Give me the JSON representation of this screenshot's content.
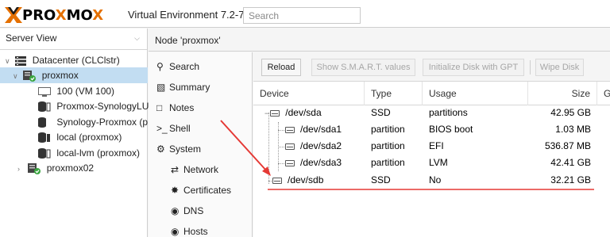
{
  "header": {
    "logo_prefix": "PRO",
    "logo_x1": "X",
    "logo_mid": "MO",
    "logo_x2": "X",
    "version_text": "Virtual Environment 7.2-7",
    "search_placeholder": "Search"
  },
  "tree": {
    "view_label": "Server View",
    "items": [
      {
        "label": "Datacenter (CLClstr)",
        "icon": "datacenter-icon"
      },
      {
        "label": "proxmox",
        "icon": "node-online-icon"
      },
      {
        "label": "100 (VM 100)",
        "icon": "vm-icon"
      },
      {
        "label": "Proxmox-SynologyLU",
        "icon": "storage-icon"
      },
      {
        "label": "Synology-Proxmox (p",
        "icon": "storage-icon"
      },
      {
        "label": "local (proxmox)",
        "icon": "storage-icon"
      },
      {
        "label": "local-lvm (proxmox)",
        "icon": "storage-icon"
      },
      {
        "label": "proxmox02",
        "icon": "node-online-icon"
      }
    ]
  },
  "node_header": "Node 'proxmox'",
  "nav": {
    "items": [
      {
        "label": "Search",
        "icon": "search-icon"
      },
      {
        "label": "Summary",
        "icon": "book-icon"
      },
      {
        "label": "Notes",
        "icon": "notes-icon"
      },
      {
        "label": "Shell",
        "icon": "terminal-icon"
      },
      {
        "label": "System",
        "icon": "gears-icon"
      },
      {
        "label": "Network",
        "icon": "exchange-icon"
      },
      {
        "label": "Certificates",
        "icon": "certificate-icon"
      },
      {
        "label": "DNS",
        "icon": "globe-icon"
      },
      {
        "label": "Hosts",
        "icon": "globe-icon"
      }
    ]
  },
  "toolbar": {
    "reload": "Reload",
    "smart": "Show S.M.A.R.T. values",
    "init_gpt": "Initialize Disk with GPT",
    "wipe": "Wipe Disk"
  },
  "table": {
    "headers": {
      "device": "Device",
      "type": "Type",
      "usage": "Usage",
      "size": "Size",
      "extra": "G"
    },
    "rows": [
      {
        "device": "/dev/sda",
        "type": "SSD",
        "usage": "partitions",
        "size": "42.95 GB"
      },
      {
        "device": "/dev/sda1",
        "type": "partition",
        "usage": "BIOS boot",
        "size": "1.03 MB"
      },
      {
        "device": "/dev/sda2",
        "type": "partition",
        "usage": "EFI",
        "size": "536.87 MB"
      },
      {
        "device": "/dev/sda3",
        "type": "partition",
        "usage": "LVM",
        "size": "42.41 GB"
      },
      {
        "device": "/dev/sdb",
        "type": "SSD",
        "usage": "No",
        "size": "32.21 GB"
      }
    ]
  },
  "colors": {
    "accent": "#e57000",
    "selection": "#c2ddf2",
    "annotation": "#e53935"
  }
}
